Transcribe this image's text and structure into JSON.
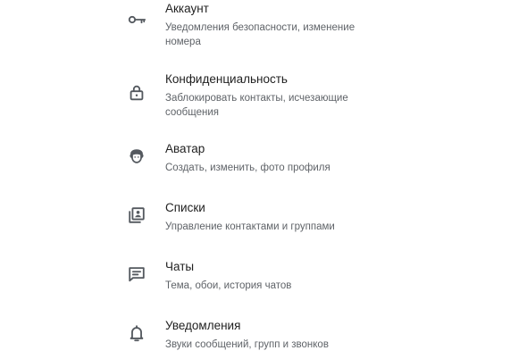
{
  "settings": {
    "items": [
      {
        "icon": "key-icon",
        "title": "Аккаунт",
        "subtitle": "Уведомления безопасности, изменение номера"
      },
      {
        "icon": "lock-icon",
        "title": "Конфиденциальность",
        "subtitle": "Заблокировать контакты, исчезающие сообщения"
      },
      {
        "icon": "avatar-icon",
        "title": "Аватар",
        "subtitle": "Создать, изменить, фото профиля"
      },
      {
        "icon": "contacts-list-icon",
        "title": "Списки",
        "subtitle": "Управление контактами и группами"
      },
      {
        "icon": "chat-icon",
        "title": "Чаты",
        "subtitle": "Тема, обои, история чатов"
      },
      {
        "icon": "bell-icon",
        "title": "Уведомления",
        "subtitle": "Звуки сообщений, групп и звонков"
      }
    ]
  },
  "colors": {
    "icon": "#54595f",
    "title": "#1f1f1f",
    "subtitle": "#5f6368"
  }
}
